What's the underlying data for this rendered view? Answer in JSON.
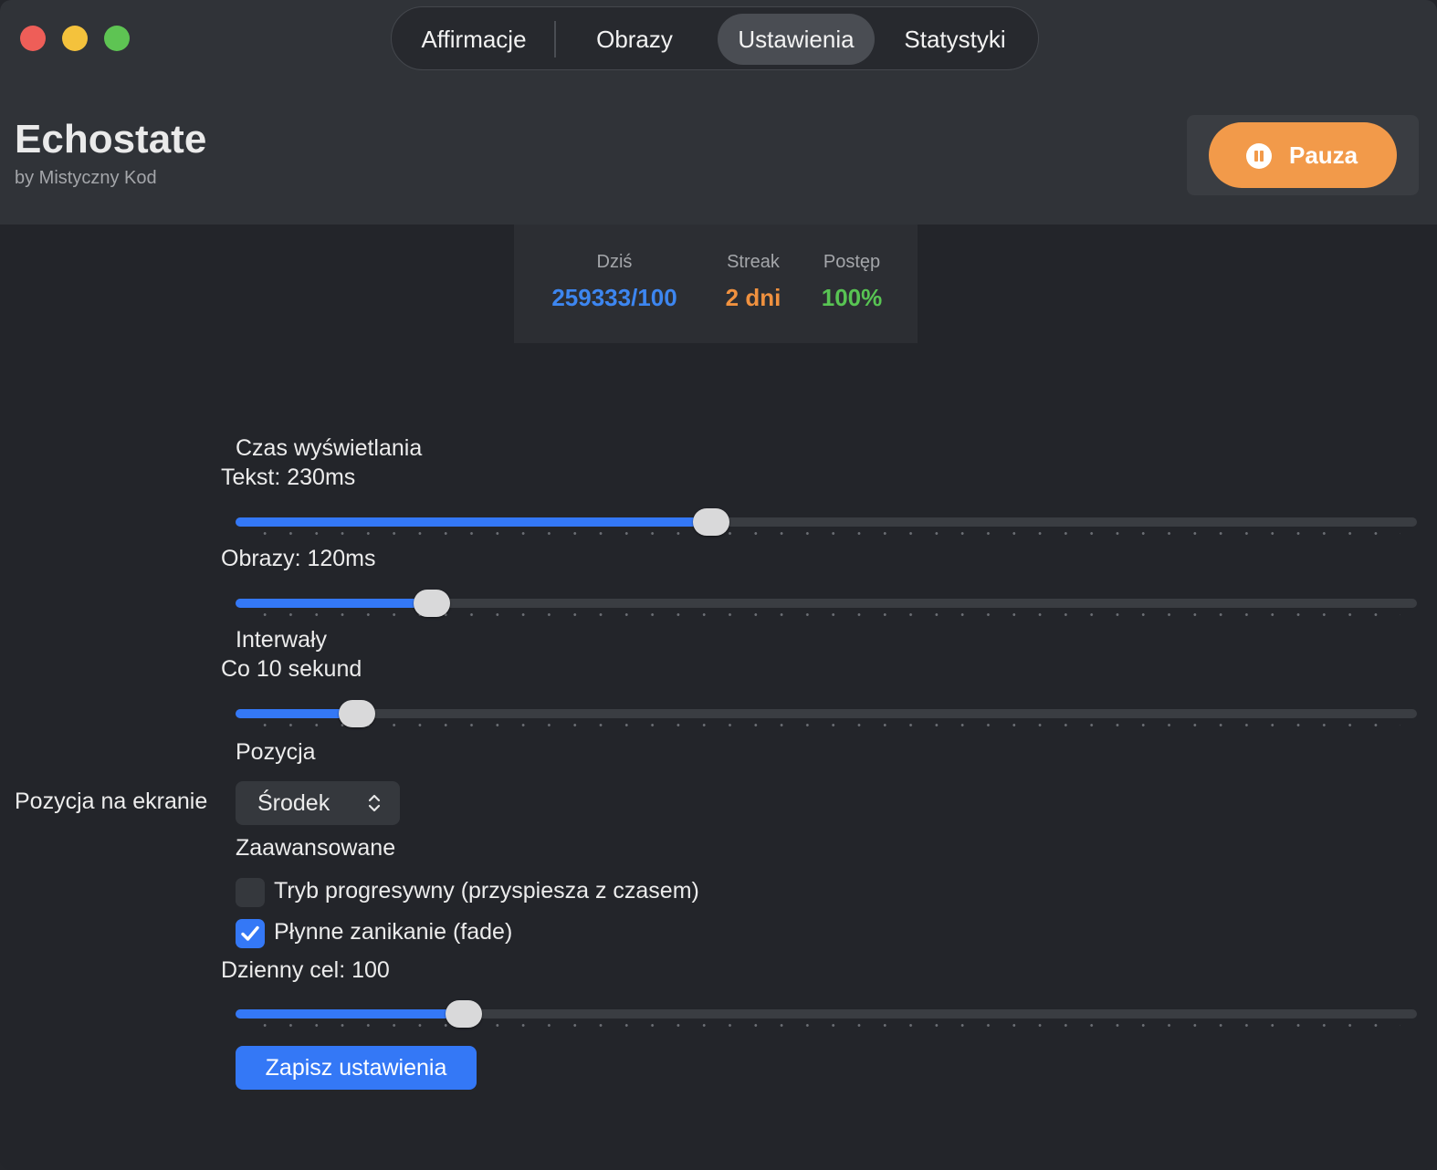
{
  "tabs": [
    {
      "label": "Affirmacje",
      "active": false
    },
    {
      "label": "Obrazy",
      "active": false
    },
    {
      "label": "Ustawienia",
      "active": true
    },
    {
      "label": "Statystyki",
      "active": false
    }
  ],
  "app": {
    "title": "Echostate",
    "subtitle": "by Mistyczny Kod"
  },
  "pause_button": {
    "label": "Pauza",
    "icon": "pause-circle-icon"
  },
  "stats": {
    "today": {
      "label": "Dziś",
      "value": "259333/100",
      "color": "#3d86f0"
    },
    "streak": {
      "label": "Streak",
      "value": "2 dni",
      "color": "#f0913f"
    },
    "progress": {
      "label": "Postęp",
      "value": "100%",
      "color": "#58c453"
    }
  },
  "display_time": {
    "section_label": "Czas wyświetlania",
    "text_label": "Tekst: 230ms",
    "text_slider_fraction": 0.403,
    "images_label": "Obrazy: 120ms",
    "images_slider_fraction": 0.166
  },
  "intervals": {
    "section_label": "Interwały",
    "value_label": "Co 10 sekund",
    "slider_fraction": 0.103
  },
  "position": {
    "section_label": "Pozycja",
    "field_label": "Pozycja na ekranie",
    "selected": "Środek"
  },
  "advanced": {
    "section_label": "Zaawansowane",
    "progressive": {
      "label": "Tryb progresywny (przyspiesza z czasem)",
      "checked": false
    },
    "fade": {
      "label": "Płynne zanikanie (fade)",
      "checked": true
    }
  },
  "daily_goal": {
    "label": "Dzienny cel: 100",
    "slider_fraction": 0.193
  },
  "save_button": {
    "label": "Zapisz ustawienia"
  },
  "colors": {
    "accent": "#3478f6",
    "pause": "#f29a4a"
  }
}
